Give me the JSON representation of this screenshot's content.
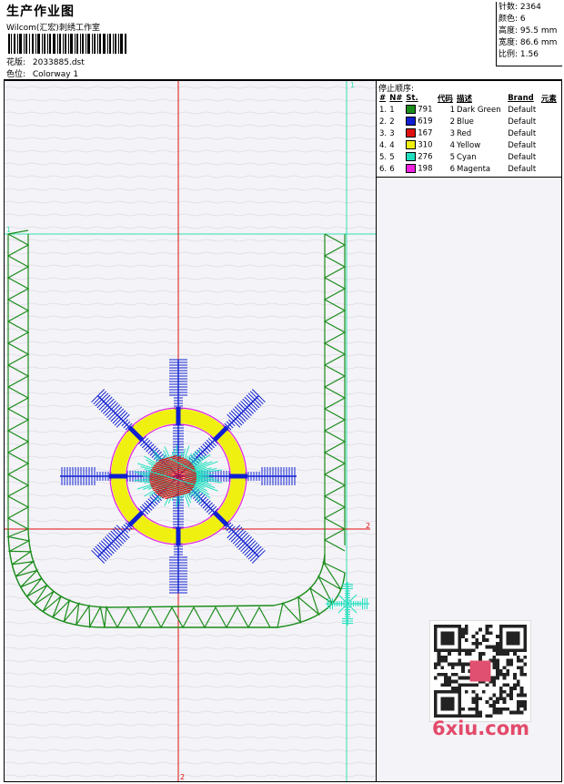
{
  "header": {
    "title": "生产作业图",
    "subtitle": "Wilcom(汇宏)刺绣工作室",
    "design_label": "花版:",
    "design_value": "2033885.dst",
    "colorway_label": "色位:",
    "colorway_value": "Colorway 1"
  },
  "stats": [
    {
      "label": "针数:",
      "value": "2364"
    },
    {
      "label": "颜色:",
      "value": "6"
    },
    {
      "label": "高度:",
      "value": "95.5 mm"
    },
    {
      "label": "宽度:",
      "value": "86.6 mm"
    },
    {
      "label": "比例:",
      "value": "1.56"
    }
  ],
  "sequence": {
    "title": "停止顺序:",
    "headers": [
      "#",
      "N#",
      "St.",
      "代码",
      "描述",
      "Brand",
      "元素"
    ],
    "rows": [
      {
        "num": "1.",
        "n": "1",
        "color": "#1a8c1a",
        "st": "791",
        "code": "1",
        "desc": "Dark Green",
        "brand": "Default"
      },
      {
        "num": "2.",
        "n": "2",
        "color": "#1020d0",
        "st": "619",
        "code": "2",
        "desc": "Blue",
        "brand": "Default"
      },
      {
        "num": "3.",
        "n": "3",
        "color": "#e01010",
        "st": "167",
        "code": "3",
        "desc": "Red",
        "brand": "Default"
      },
      {
        "num": "4.",
        "n": "4",
        "color": "#f0f010",
        "st": "310",
        "code": "4",
        "desc": "Yellow",
        "brand": "Default"
      },
      {
        "num": "5.",
        "n": "5",
        "color": "#20e0c0",
        "st": "276",
        "code": "5",
        "desc": "Cyan",
        "brand": "Default"
      },
      {
        "num": "6.",
        "n": "6",
        "color": "#f020e0",
        "st": "198",
        "code": "6",
        "desc": "Magenta",
        "brand": "Default"
      }
    ]
  },
  "guides": {
    "h1": "1",
    "h2": "2",
    "v1": "1",
    "v2": "2"
  },
  "watermark": "6xiu.com",
  "colors": {
    "guide_red": "#e01010",
    "guide_cyan": "#30e0b0",
    "green": "#1a8c1a",
    "blue": "#1020d0",
    "yellow": "#f0f010",
    "magenta": "#e020e0",
    "cyan": "#20e0c0",
    "red": "#e01010"
  }
}
